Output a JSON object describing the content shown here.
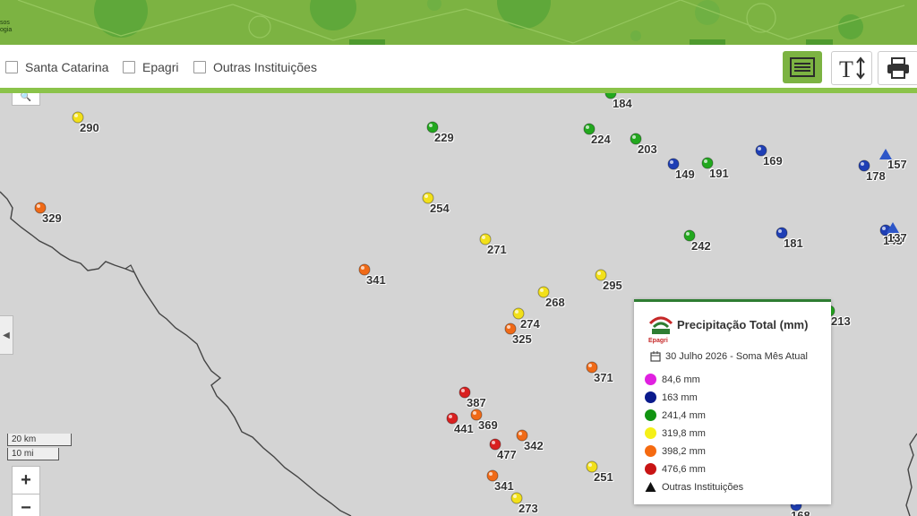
{
  "header": {
    "logo_line1": "sos",
    "logo_line2": "ogia"
  },
  "filters": [
    {
      "label": "Santa Catarina",
      "checked": false
    },
    {
      "label": "Epagri",
      "checked": false
    },
    {
      "label": "Outras Instituições",
      "checked": false
    }
  ],
  "toolbar": {
    "list_icon": "list-icon",
    "text_size_icon": "text-size-icon",
    "print_icon": "printer-icon"
  },
  "map": {
    "scale_km": "20 km",
    "scale_mi": "10 mi",
    "zoom_in": "+",
    "zoom_out": "−",
    "stations": [
      {
        "value": "290",
        "color": "#f2e01a",
        "shape": "circle"
      },
      {
        "value": "229",
        "color": "#22a81e",
        "shape": "circle"
      },
      {
        "value": "224",
        "color": "#22a81e",
        "shape": "circle"
      },
      {
        "value": "184",
        "color": "#22a81e",
        "shape": "circle"
      },
      {
        "value": "203",
        "color": "#22a81e",
        "shape": "circle"
      },
      {
        "value": "149",
        "color": "#1f3fb5",
        "shape": "circle"
      },
      {
        "value": "191",
        "color": "#22a81e",
        "shape": "circle"
      },
      {
        "value": "169",
        "color": "#1f3fb5",
        "shape": "circle"
      },
      {
        "value": "178",
        "color": "#1f3fb5",
        "shape": "circle"
      },
      {
        "value": "157",
        "color": "#2d56c8",
        "shape": "triangle"
      },
      {
        "value": "329",
        "color": "#f06a17",
        "shape": "circle"
      },
      {
        "value": "254",
        "color": "#f2e01a",
        "shape": "circle"
      },
      {
        "value": "271",
        "color": "#f2e01a",
        "shape": "circle"
      },
      {
        "value": "242",
        "color": "#22a81e",
        "shape": "circle"
      },
      {
        "value": "181",
        "color": "#1f3fb5",
        "shape": "circle"
      },
      {
        "value": "143",
        "color": "#1f3fb5",
        "shape": "circle"
      },
      {
        "value": "137",
        "color": "#2d56c8",
        "shape": "triangle"
      },
      {
        "value": "341",
        "color": "#f06a17",
        "shape": "circle"
      },
      {
        "value": "295",
        "color": "#f2e01a",
        "shape": "circle"
      },
      {
        "value": "268",
        "color": "#f2e01a",
        "shape": "circle"
      },
      {
        "value": "274",
        "color": "#f2e01a",
        "shape": "circle"
      },
      {
        "value": "325",
        "color": "#f06a17",
        "shape": "circle"
      },
      {
        "value": "213",
        "color": "#22a81e",
        "shape": "circle"
      },
      {
        "value": "371",
        "color": "#f06a17",
        "shape": "circle"
      },
      {
        "value": "387",
        "color": "#d92020",
        "shape": "circle"
      },
      {
        "value": "369",
        "color": "#f06a17",
        "shape": "circle"
      },
      {
        "value": "441",
        "color": "#d92020",
        "shape": "circle"
      },
      {
        "value": "477",
        "color": "#d92020",
        "shape": "circle"
      },
      {
        "value": "342",
        "color": "#f06a17",
        "shape": "circle"
      },
      {
        "value": "251",
        "color": "#f2e01a",
        "shape": "circle"
      },
      {
        "value": "341",
        "color": "#f06a17",
        "shape": "circle"
      },
      {
        "value": "273",
        "color": "#f2e01a",
        "shape": "circle"
      },
      {
        "value": "168",
        "color": "#1f3fb5",
        "shape": "circle"
      }
    ]
  },
  "legend": {
    "brand": "Epagri",
    "title": "Precipitação Total (mm)",
    "date": "30 Julho 2026 - Soma Mês Atual",
    "items": [
      {
        "label": "84,6 mm",
        "color": "#e020e0"
      },
      {
        "label": "163 mm",
        "color": "#0a1a8c"
      },
      {
        "label": "241,4 mm",
        "color": "#119411"
      },
      {
        "label": "319,8 mm",
        "color": "#f5f018"
      },
      {
        "label": "398,2 mm",
        "color": "#f56a10"
      },
      {
        "label": "476,6 mm",
        "color": "#c81414"
      }
    ],
    "other": "Outras Instituições"
  }
}
